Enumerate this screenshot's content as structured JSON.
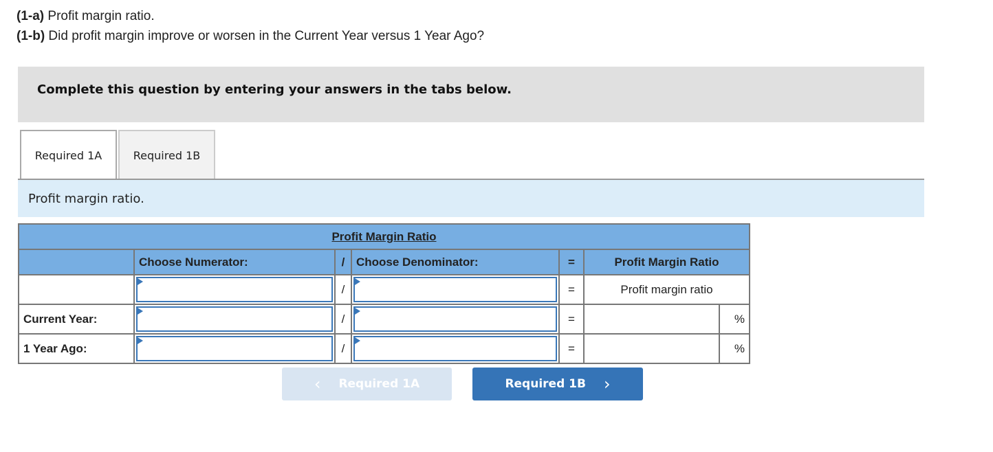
{
  "questions": [
    {
      "label": "(1-a)",
      "text": " Profit margin ratio."
    },
    {
      "label": "(1-b)",
      "text": " Did profit margin improve or worsen in the Current Year versus 1 Year Ago?"
    }
  ],
  "instruction": "Complete this question by entering your answers in the tabs below.",
  "tabs": [
    {
      "label": "Required 1A",
      "active": true
    },
    {
      "label": "Required 1B",
      "active": false
    }
  ],
  "panel_title": "Profit margin ratio.",
  "table": {
    "title": "Profit Margin Ratio",
    "headers": {
      "numerator": "Choose Numerator:",
      "div": "/",
      "denominator": "Choose Denominator:",
      "eq": "=",
      "result": "Profit Margin Ratio"
    },
    "rows": [
      {
        "label": "",
        "result": "Profit margin ratio",
        "unit": ""
      },
      {
        "label": "Current Year:",
        "result": "",
        "unit": "%"
      },
      {
        "label": "1 Year Ago:",
        "result": "",
        "unit": "%"
      }
    ],
    "div_symbol": "/",
    "eq_symbol": "="
  },
  "nav": {
    "prev_label": "Required 1A",
    "next_label": "Required 1B",
    "prev_icon": "‹",
    "next_icon": "›"
  }
}
